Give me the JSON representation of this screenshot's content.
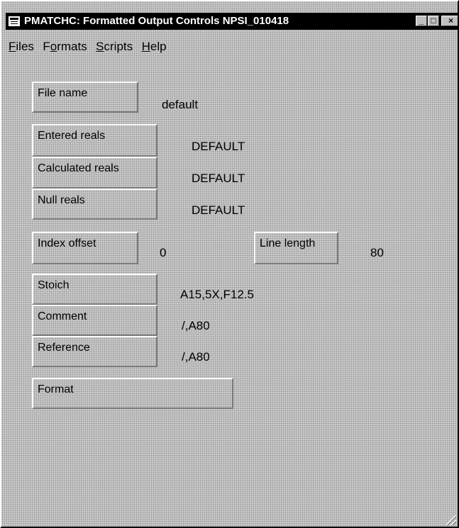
{
  "window": {
    "title": "PMATCHC: Formatted Output Controls NPSI_010418",
    "controls": {
      "minimize": "_",
      "maximize": "□",
      "close": "×"
    }
  },
  "menu": [
    {
      "label": "Files",
      "accel": "F",
      "rest": "iles"
    },
    {
      "label": "Formats",
      "accel": "o",
      "pre": "F",
      "rest": "rmats"
    },
    {
      "label": "Scripts",
      "accel": "S",
      "rest": "cripts"
    },
    {
      "label": "Help",
      "accel": "H",
      "rest": "elp"
    }
  ],
  "fields": {
    "file_name": {
      "label": "File name",
      "value": "default"
    },
    "entered_reals": {
      "label": "Entered reals",
      "value": "DEFAULT"
    },
    "calculated_reals": {
      "label": "Calculated reals",
      "value": "DEFAULT"
    },
    "null_reals": {
      "label": "Null reals",
      "value": "DEFAULT"
    },
    "index_offset": {
      "label": "Index offset",
      "value": "0"
    },
    "line_length": {
      "label": "Line length",
      "value": "80"
    },
    "stoich": {
      "label": "Stoich",
      "value": "A15,5X,F12.5"
    },
    "comment": {
      "label": "Comment",
      "value": "/,A80"
    },
    "reference": {
      "label": "Reference",
      "value": "/,A80"
    },
    "format": {
      "label": "Format"
    }
  }
}
